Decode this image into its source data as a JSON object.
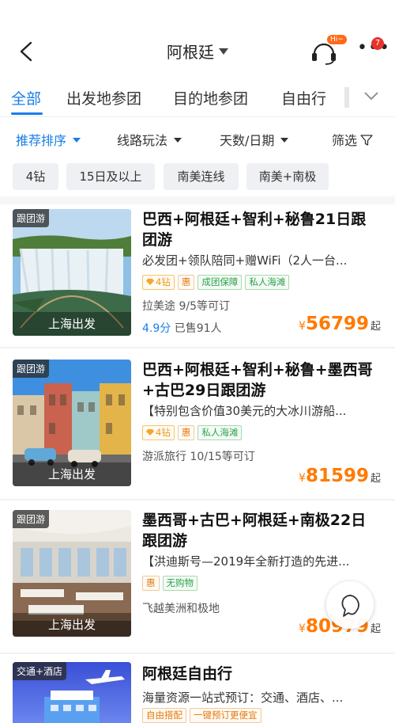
{
  "header": {
    "title": "阿根廷",
    "service_badge": "Hi~",
    "more_count": "7"
  },
  "tabs": [
    {
      "label": "全部"
    },
    {
      "label": "出发地参团"
    },
    {
      "label": "目的地参团"
    },
    {
      "label": "自由行"
    }
  ],
  "filters": [
    {
      "label": "推荐排序"
    },
    {
      "label": "线路玩法"
    },
    {
      "label": "天数/日期"
    },
    {
      "label": "筛选"
    }
  ],
  "chips": [
    "4钻",
    "15日及以上",
    "南美连线",
    "南美+南极"
  ],
  "products": [
    {
      "tag": "跟团游",
      "departure": "上海出发",
      "title": "巴西+阿根廷+智利+秘鲁21日跟团游",
      "subtitle": "必发团+领队陪同+赠WiFi（2人一台...",
      "badges": [
        "4钻",
        "惠",
        "成团保障",
        "私人海滩"
      ],
      "supplier": "拉美途  9/5等可订",
      "rating": "4.9分",
      "sold": "已售91人",
      "currency": "¥",
      "price": "56799",
      "price_suffix": "起"
    },
    {
      "tag": "跟团游",
      "departure": "上海出发",
      "title": "巴西+阿根廷+智利+秘鲁+墨西哥+古巴29日跟团游",
      "subtitle": "【特别包含价值30美元的大冰川游船...",
      "badges": [
        "4钻",
        "惠",
        "私人海滩"
      ],
      "supplier": "游派旅行  10/15等可订",
      "currency": "¥",
      "price": "81599",
      "price_suffix": "起"
    },
    {
      "tag": "跟团游",
      "departure": "上海出发",
      "title": "墨西哥+古巴+阿根廷+南极22日跟团游",
      "subtitle": "【洪迪斯号—2019年全新打造的先进...",
      "badges": [
        "惠",
        "无购物"
      ],
      "supplier": "飞越美洲和极地",
      "currency": "¥",
      "price": "80979",
      "price_suffix": "起"
    },
    {
      "tag": "交通+酒店",
      "title": "阿根廷自由行",
      "subtitle": "海量资源一站式预订：交通、酒店、...",
      "badges": [
        "自由搭配",
        "一键预订更便宜"
      ]
    }
  ],
  "colors": {
    "accent": "#1a7de8",
    "price": "#ff7a00",
    "badge_orange": "#e47a10",
    "badge_green": "#2aa14a"
  }
}
